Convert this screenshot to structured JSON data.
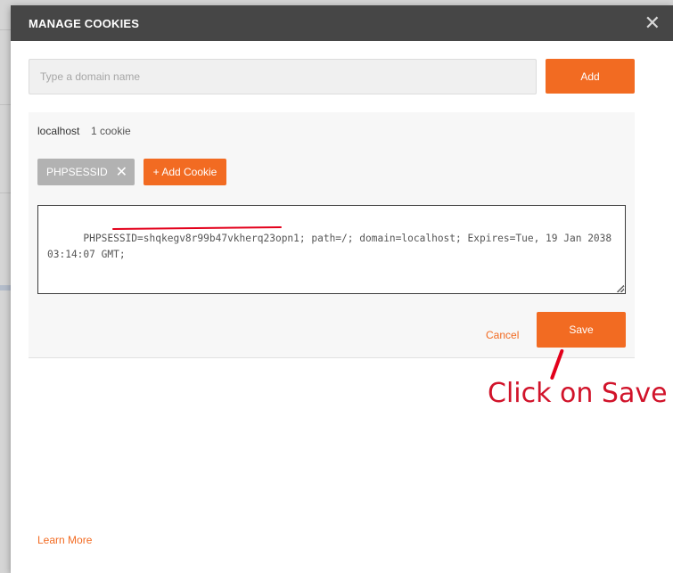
{
  "modal": {
    "title": "MANAGE COOKIES",
    "close_icon": "close-icon"
  },
  "domain_input": {
    "placeholder": "Type a domain name",
    "value": ""
  },
  "add_button": {
    "label": "Add"
  },
  "cookie_group": {
    "domain": "localhost",
    "count_text": "1 cookie",
    "chips": [
      {
        "label": "PHPSESSID",
        "remove_icon": "close-icon"
      }
    ],
    "add_cookie_label": "+ Add Cookie"
  },
  "cookie_editor": {
    "value": "PHPSESSID=shqkegv8r99b47vkherq23opn1; path=/; domain=localhost; Expires=Tue, 19 Jan 2038 03:14:07 GMT;"
  },
  "actions": {
    "cancel_label": "Cancel",
    "save_label": "Save"
  },
  "footer": {
    "learn_more_label": "Learn More"
  },
  "annotation": {
    "text": "Click on Save",
    "color": "#d1132a"
  },
  "colors": {
    "accent": "#f26b22",
    "header_bg": "#464646",
    "chip_bg": "#b2b2b2"
  }
}
